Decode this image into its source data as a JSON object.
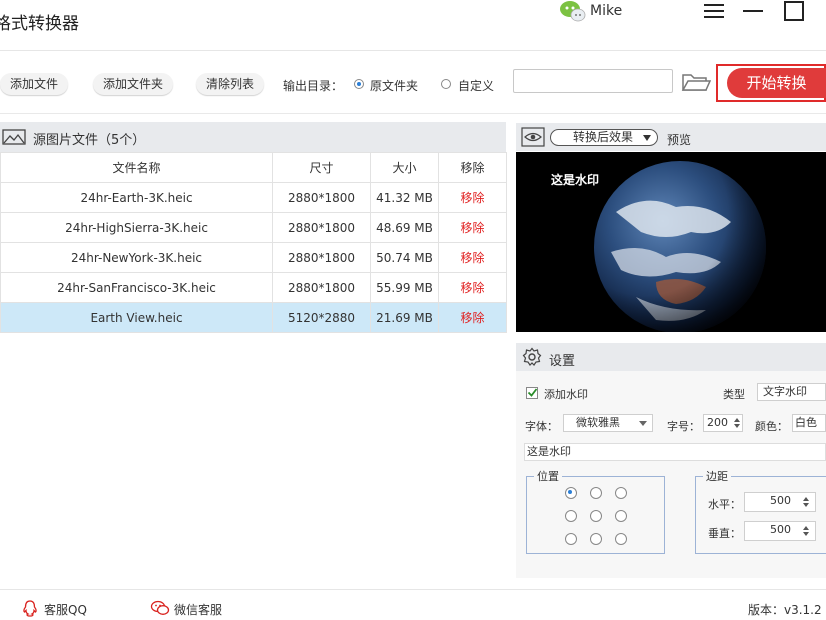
{
  "app": {
    "title": "格式转换器",
    "user_name": "Mike"
  },
  "toolbar": {
    "add_file": "添加文件",
    "add_folder": "添加文件夹",
    "clear_list": "清除列表",
    "output_dir_label": "输出目录：",
    "opt_source_folder": "原文件夹",
    "opt_custom": "自定义",
    "output_path_value": "",
    "selected_output": "原文件夹",
    "start_button": "开始转换"
  },
  "file_list": {
    "header": "源图片文件（5个）",
    "columns": [
      "文件名称",
      "尺寸",
      "大小",
      "移除"
    ],
    "rows": [
      {
        "name": "24hr-Earth-3K.heic",
        "size": "2880*1800",
        "filesize": "41.32 MB",
        "remove": "移除",
        "selected": false
      },
      {
        "name": "24hr-HighSierra-3K.heic",
        "size": "2880*1800",
        "filesize": "48.69 MB",
        "remove": "移除",
        "selected": false
      },
      {
        "name": "24hr-NewYork-3K.heic",
        "size": "2880*1800",
        "filesize": "50.74 MB",
        "remove": "移除",
        "selected": false
      },
      {
        "name": "24hr-SanFrancisco-3K.heic",
        "size": "2880*1800",
        "filesize": "55.99 MB",
        "remove": "移除",
        "selected": false
      },
      {
        "name": "Earth View.heic",
        "size": "5120*2880",
        "filesize": "21.69 MB",
        "remove": "移除",
        "selected": true
      }
    ]
  },
  "preview": {
    "effect_select": "转换后效果",
    "label": "预览",
    "watermark_text": "这是水印"
  },
  "settings": {
    "title": "设置",
    "add_watermark_label": "添加水印",
    "add_watermark_checked": true,
    "type_label": "类型",
    "type_value": "文字水印",
    "font_label": "字体：",
    "font_value": "微软雅黑",
    "size_label": "字号：",
    "size_value": "200",
    "color_label": "颜色：",
    "color_value": "白色",
    "watermark_text": "这是水印",
    "position_title": "位置",
    "position_selected": 0,
    "margin_title": "边距",
    "horizontal_label": "水平：",
    "horizontal_value": "500",
    "vertical_label": "垂直：",
    "vertical_value": "500"
  },
  "footer": {
    "qq_label": "客服QQ",
    "wechat_label": "微信客服",
    "version": "版本：v3.1.2"
  },
  "colors": {
    "accent_red": "#e03b3b",
    "remove_red": "#e02020",
    "selected_row": "#cde8f8",
    "header_gray": "#e8eaed"
  },
  "icons": [
    "wechat-avatar-icon",
    "menu-icon",
    "minimize-icon",
    "maximize-icon",
    "folder-icon",
    "image-icon",
    "eye-icon",
    "gear-icon",
    "qq-icon",
    "wechat-icon"
  ]
}
